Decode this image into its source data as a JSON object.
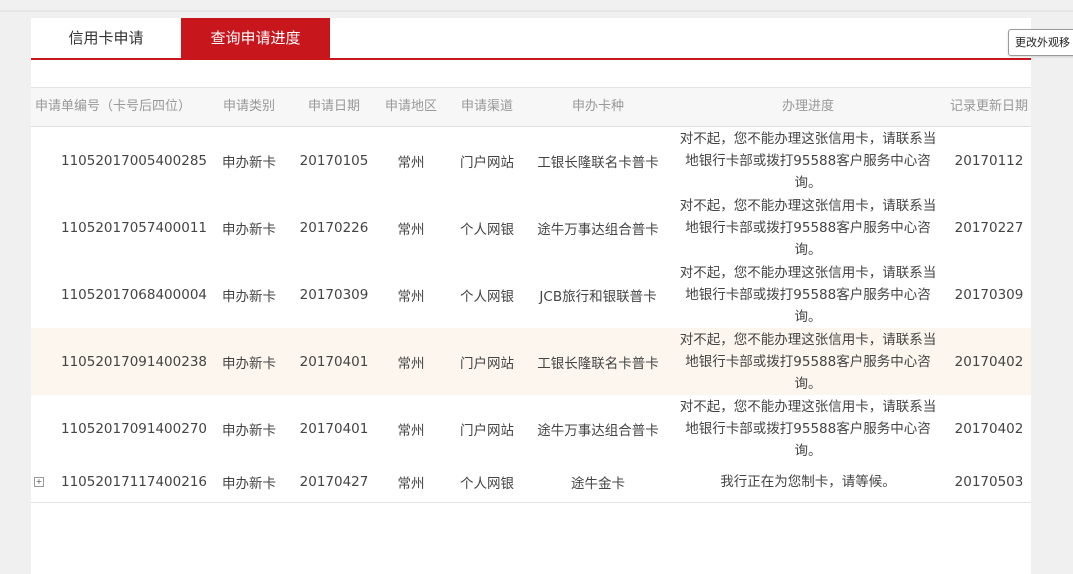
{
  "tabs": [
    {
      "label": "信用卡申请",
      "active": false
    },
    {
      "label": "查询申请进度",
      "active": true
    }
  ],
  "side_button_label": "更改外观移",
  "colors": {
    "accent": "#c8161d",
    "highlight_row": "#fdf6ef"
  },
  "table": {
    "headers": [
      "申请单编号（卡号后四位）",
      "申请类别",
      "申请日期",
      "申请地区",
      "申请渠道",
      "申办卡种",
      "办理进度",
      "记录更新日期"
    ],
    "rows": [
      {
        "id": "11052017005400285",
        "category": "申办新卡",
        "date": "20170105",
        "region": "常州",
        "channel": "门户网站",
        "card": "工银长隆联名卡普卡",
        "progress": [
          "对不起，您不能办理这张信用卡，请联系当",
          "地银行卡部或拨打95588客户服务中心咨",
          "询。"
        ],
        "updated": "20170112"
      },
      {
        "id": "11052017057400011",
        "category": "申办新卡",
        "date": "20170226",
        "region": "常州",
        "channel": "个人网银",
        "card": "途牛万事达组合普卡",
        "progress": [
          "对不起，您不能办理这张信用卡，请联系当",
          "地银行卡部或拨打95588客户服务中心咨",
          "询。"
        ],
        "updated": "20170227"
      },
      {
        "id": "11052017068400004",
        "category": "申办新卡",
        "date": "20170309",
        "region": "常州",
        "channel": "个人网银",
        "card": "JCB旅行和银联普卡",
        "progress": [
          "对不起，您不能办理这张信用卡，请联系当",
          "地银行卡部或拨打95588客户服务中心咨",
          "询。"
        ],
        "updated": "20170309"
      },
      {
        "id": "11052017091400238",
        "category": "申办新卡",
        "date": "20170401",
        "region": "常州",
        "channel": "门户网站",
        "card": "工银长隆联名卡普卡",
        "progress": [
          "对不起，您不能办理这张信用卡，请联系当",
          "地银行卡部或拨打95588客户服务中心咨",
          "询。"
        ],
        "updated": "20170402"
      },
      {
        "id": "11052017091400270",
        "category": "申办新卡",
        "date": "20170401",
        "region": "常州",
        "channel": "门户网站",
        "card": "途牛万事达组合普卡",
        "progress": [
          "对不起，您不能办理这张信用卡，请联系当",
          "地银行卡部或拨打95588客户服务中心咨",
          "询。"
        ],
        "updated": "20170402"
      },
      {
        "id": "11052017117400216",
        "category": "申办新卡",
        "date": "20170427",
        "region": "常州",
        "channel": "个人网银",
        "card": "途牛金卡",
        "progress": [
          "我行正在为您制卡，请等候。"
        ],
        "updated": "20170503",
        "expand_icon": "+"
      }
    ]
  }
}
